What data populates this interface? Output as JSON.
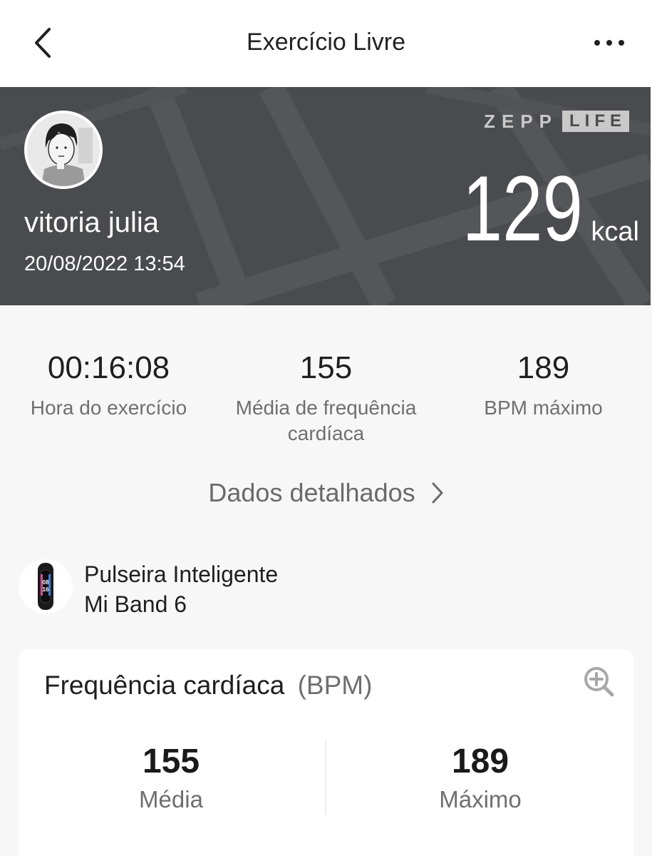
{
  "header": {
    "title": "Exercício Livre",
    "back_icon": "chevron-left-icon",
    "more_icon": "more-dots-icon"
  },
  "banner": {
    "username": "vitoria julia",
    "datetime": "20/08/2022 13:54",
    "brand_part1": "ZEPP",
    "brand_part2": "LIFE",
    "calories_value": "129",
    "calories_unit": "kcal",
    "background_color": "#4a4b4f"
  },
  "stats": [
    {
      "value": "00:16:08",
      "label": "Hora do exercício"
    },
    {
      "value": "155",
      "label": "Média de frequência cardíaca"
    },
    {
      "value": "189",
      "label": "BPM máximo"
    }
  ],
  "detail_link": {
    "label": "Dados detalhados",
    "icon": "chevron-right-icon"
  },
  "device": {
    "name_line1": "Pulseira Inteligente",
    "name_line2": "Mi Band 6",
    "icon": "smart-band-icon",
    "screen_time": [
      "08",
      "16"
    ]
  },
  "heart_rate_card": {
    "title": "Frequência cardíaca",
    "unit": "(BPM)",
    "zoom_icon": "zoom-in-icon",
    "average_value": "155",
    "average_label": "Média",
    "max_value": "189",
    "max_label": "Máximo"
  }
}
